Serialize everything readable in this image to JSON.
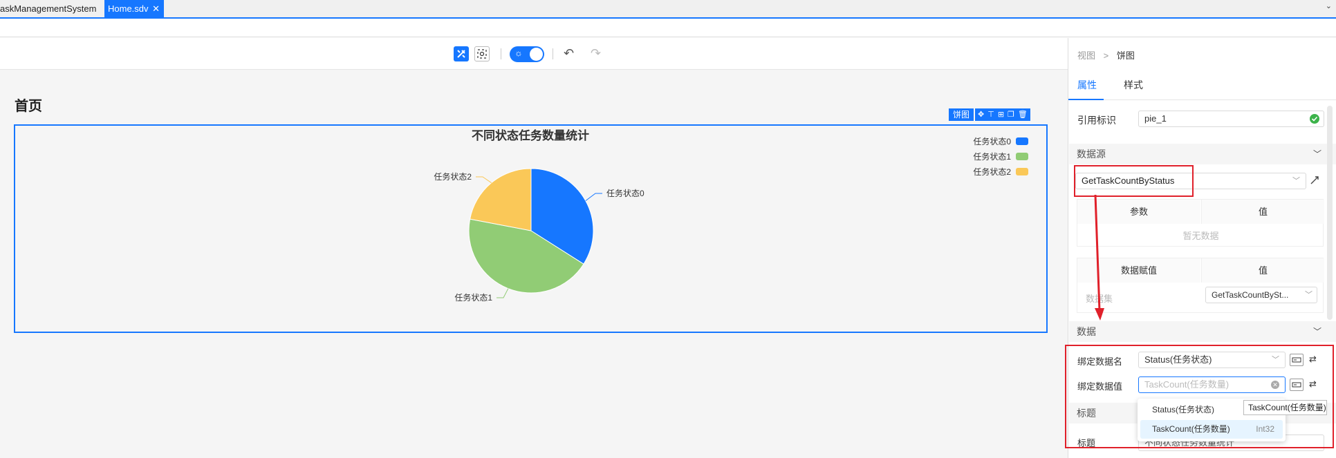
{
  "tabs": {
    "project": "askManagementSystem",
    "file": "Home.sdv",
    "close": "✕",
    "chevron": "⌄"
  },
  "toolbar": {
    "design_icon": "design-mode-icon",
    "preview_icon": "preview-icon",
    "theme_icon": "sun-icon",
    "undo": "↶",
    "redo": "↷"
  },
  "page": {
    "title": "首页"
  },
  "widget": {
    "tag": "饼图",
    "tools": [
      "✥",
      "⊤",
      "⊞",
      "❐",
      "🗑"
    ]
  },
  "chart_data": {
    "type": "pie",
    "title": "不同状态任务数量统计",
    "categories": [
      "任务状态0",
      "任务状态1",
      "任务状态2"
    ],
    "values": [
      34,
      44,
      22
    ],
    "colors": [
      "#1677ff",
      "#91cc75",
      "#fac858"
    ],
    "legend_position": "top-right"
  },
  "panel": {
    "breadcrumb_root": "视图",
    "breadcrumb_sep": ">",
    "breadcrumb_current": "饼图",
    "tab_props": "属性",
    "tab_style": "样式",
    "ref_label": "引用标识",
    "ref_value": "pie_1",
    "section_datasource": "数据源",
    "datasource_value": "GetTaskCountByStatus",
    "param_col": "参数",
    "value_col": "值",
    "empty_text": "暂无数据",
    "assign_col": "数据赋值",
    "assign_value_col": "值",
    "dataset_label": "数据集",
    "dataset_value": "GetTaskCountBySt...",
    "section_data": "数据",
    "bind_name_label": "绑定数据名",
    "bind_name_value": "Status(任务状态)",
    "bind_value_label": "绑定数据值",
    "bind_value_placeholder": "TaskCount(任务数量)",
    "section_title": "标题",
    "title_label": "标题",
    "title_value": "不同状态任务数量统计"
  },
  "dropdown": {
    "items": [
      {
        "label": "Status(任务状态)",
        "type": ""
      },
      {
        "label": "TaskCount(任务数量)",
        "type": "Int32"
      }
    ]
  },
  "tooltip": {
    "text": "TaskCount(任务数量)"
  }
}
